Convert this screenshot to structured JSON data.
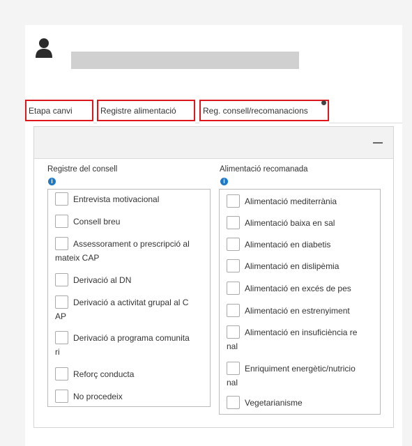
{
  "tabs": [
    {
      "label": "Etapa canvi"
    },
    {
      "label": "Registre alimentació"
    },
    {
      "label": "Reg. consell/recomanacions"
    }
  ],
  "left_section": {
    "title": "Registre del consell",
    "items": [
      {
        "line1": "Entrevista motivacional",
        "line2": ""
      },
      {
        "line1": "Consell breu",
        "line2": ""
      },
      {
        "line1": "Assessorament o prescripció al",
        "line2": "mateix CAP"
      },
      {
        "line1": "Derivació al DN",
        "line2": ""
      },
      {
        "line1": "Derivació a activitat grupal al C",
        "line2": "AP"
      },
      {
        "line1": "Derivació a programa comunita",
        "line2": "ri"
      },
      {
        "line1": "Reforç conducta",
        "line2": ""
      },
      {
        "line1": "No procedeix",
        "line2": ""
      }
    ]
  },
  "right_section": {
    "title": "Alimentació recomanada",
    "items": [
      {
        "line1": "Alimentació mediterrània",
        "line2": ""
      },
      {
        "line1": "Alimentació baixa en sal",
        "line2": ""
      },
      {
        "line1": "Alimentació en diabetis",
        "line2": ""
      },
      {
        "line1": "Alimentació en dislipèmia",
        "line2": ""
      },
      {
        "line1": "Alimentació en excés de pes",
        "line2": ""
      },
      {
        "line1": "Alimentació en estrenyiment",
        "line2": ""
      },
      {
        "line1": "Alimentació en insuficiència re",
        "line2": "nal"
      },
      {
        "line1": "Enriquiment energètic/nutricio",
        "line2": "nal"
      },
      {
        "line1": "Vegetarianisme",
        "line2": ""
      }
    ]
  },
  "colors": {
    "highlight": "#e0161b",
    "info": "#1e78c8"
  },
  "icons": {
    "user": "user-icon",
    "info": "info-icon",
    "collapse": "minus-icon"
  }
}
